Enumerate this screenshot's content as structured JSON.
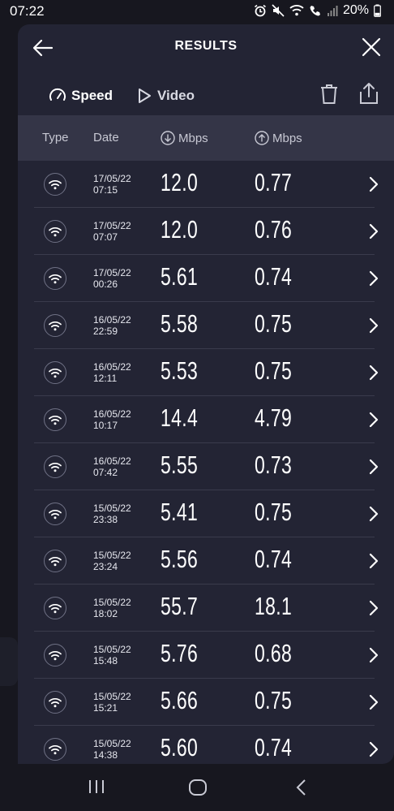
{
  "status_bar": {
    "time": "07:22",
    "battery": "20%"
  },
  "header": {
    "title": "RESULTS"
  },
  "tabs": [
    {
      "label": "Speed",
      "icon": "speedometer-icon",
      "active": true
    },
    {
      "label": "Video",
      "icon": "play-icon",
      "active": false
    }
  ],
  "table": {
    "columns": {
      "type": "Type",
      "date": "Date",
      "download": "Mbps",
      "upload": "Mbps"
    },
    "rows": [
      {
        "date": "17/05/22",
        "time": "07:15",
        "down": "12.0",
        "up": "0.77"
      },
      {
        "date": "17/05/22",
        "time": "07:07",
        "down": "12.0",
        "up": "0.76"
      },
      {
        "date": "17/05/22",
        "time": "00:26",
        "down": "5.61",
        "up": "0.74"
      },
      {
        "date": "16/05/22",
        "time": "22:59",
        "down": "5.58",
        "up": "0.75"
      },
      {
        "date": "16/05/22",
        "time": "12:11",
        "down": "5.53",
        "up": "0.75"
      },
      {
        "date": "16/05/22",
        "time": "10:17",
        "down": "14.4",
        "up": "4.79"
      },
      {
        "date": "16/05/22",
        "time": "07:42",
        "down": "5.55",
        "up": "0.73"
      },
      {
        "date": "15/05/22",
        "time": "23:38",
        "down": "5.41",
        "up": "0.75"
      },
      {
        "date": "15/05/22",
        "time": "23:24",
        "down": "5.56",
        "up": "0.74"
      },
      {
        "date": "15/05/22",
        "time": "18:02",
        "down": "55.7",
        "up": "18.1"
      },
      {
        "date": "15/05/22",
        "time": "15:48",
        "down": "5.76",
        "up": "0.68"
      },
      {
        "date": "15/05/22",
        "time": "15:21",
        "down": "5.66",
        "up": "0.75"
      },
      {
        "date": "15/05/22",
        "time": "14:38",
        "down": "5.60",
        "up": "0.74"
      }
    ]
  },
  "colors": {
    "accent": "#3fb1e6",
    "panel": "#232434",
    "header_row": "#343547"
  }
}
